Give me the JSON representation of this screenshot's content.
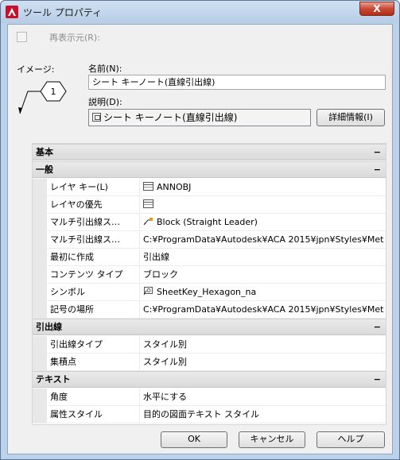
{
  "window": {
    "title": "ツール プロパティ",
    "close_glyph": "X"
  },
  "redisplay": {
    "label": "再表示元(R):",
    "checked": false
  },
  "image": {
    "label": "イメージ:",
    "symbol_number": "1"
  },
  "name": {
    "label": "名前(N):",
    "value": "シート キーノート(直線引出線)"
  },
  "description": {
    "label": "説明(D):",
    "value": "シート キーノート(直線引出線)"
  },
  "detail_button": "詳細情報(I)",
  "sections": {
    "basic": {
      "title": "基本",
      "toggle": "−"
    },
    "general": {
      "title": "一般",
      "toggle": "−"
    },
    "leader": {
      "title": "引出線",
      "toggle": "−"
    },
    "text": {
      "title": "テキスト",
      "toggle": "−"
    }
  },
  "general_rows": [
    {
      "key": "レイヤ キー(L)",
      "value": "ANNOBJ",
      "icon": "layer-icon"
    },
    {
      "key": "レイヤの優先",
      "value": "",
      "icon": "layer-icon"
    },
    {
      "key": "マルチ引出線ス…",
      "value": "Block (Straight Leader)",
      "icon": "leader-style-icon"
    },
    {
      "key": "マルチ引出線ス…",
      "value": "C:¥ProgramData¥Autodesk¥ACA  2015¥jpn¥Styles¥Metri…",
      "icon": ""
    },
    {
      "key": "最初に作成",
      "value": "引出線",
      "icon": ""
    },
    {
      "key": "コンテンツ タイプ",
      "value": "ブロック",
      "icon": ""
    },
    {
      "key": "シンボル",
      "value": "SheetKey_Hexagon_na",
      "icon": "symbol-icon"
    },
    {
      "key": "記号の場所",
      "value": "C:¥ProgramData¥Autodesk¥ACA  2015¥jpn¥Styles¥Metri…",
      "icon": ""
    }
  ],
  "leader_rows": [
    {
      "key": "引出線タイプ",
      "value": "スタイル別"
    },
    {
      "key": "集積点",
      "value": "スタイル別"
    }
  ],
  "text_rows": [
    {
      "key": "角度",
      "value": "水平にする"
    },
    {
      "key": "属性スタイル",
      "value": "目的の図面テキスト スタイル"
    }
  ],
  "buttons": {
    "ok": "OK",
    "cancel": "キャンセル",
    "help": "ヘルプ"
  },
  "colors": {
    "accent": "#bcd2ea",
    "close": "#c74a36",
    "app_icon": "#c8102e"
  }
}
